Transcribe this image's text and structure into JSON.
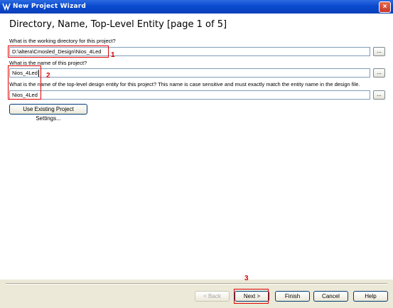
{
  "window": {
    "title": "New Project Wizard"
  },
  "page": {
    "heading": "Directory, Name, Top-Level Entity [page 1 of 5]"
  },
  "fields": {
    "working_dir_label": "What is the working directory for this project?",
    "working_dir_value": "D:\\altera\\Cmosled_Design\\Nios_4Led",
    "project_name_label": "What is the name of this project?",
    "project_name_value": "Nios_4Led",
    "top_entity_label": "What is the name of the top-level design entity for this project? This name is case sensitive and must exactly match the entity name in the design file.",
    "top_entity_value": "Nios_4Led",
    "browse_label": "..."
  },
  "buttons": {
    "use_existing": "Use Existing Project Settings...",
    "back": "< Back",
    "next": "Next >",
    "finish": "Finish",
    "cancel": "Cancel",
    "help": "Help"
  },
  "annotations": {
    "one": "1",
    "two": "2",
    "three": "3"
  },
  "colors": {
    "annotation": "#e00000",
    "titlebar": "#0a4ad0"
  }
}
